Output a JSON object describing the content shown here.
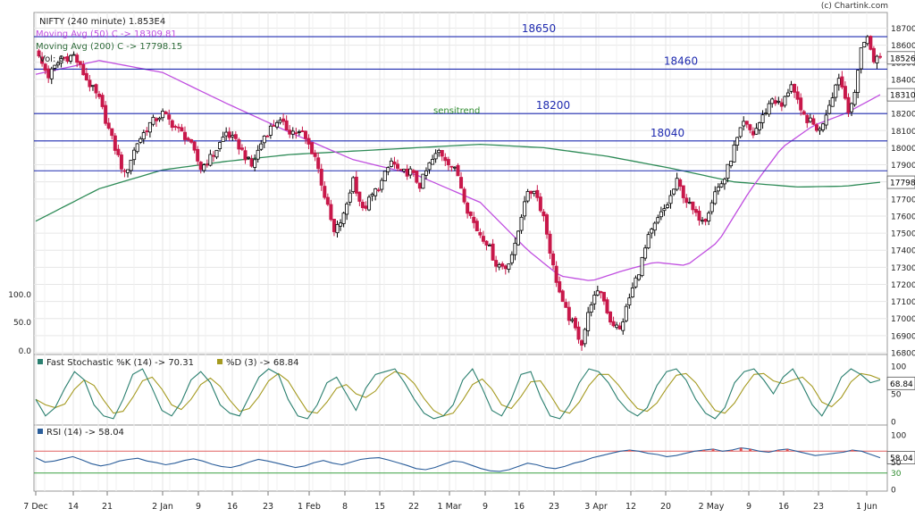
{
  "header": {
    "symbol_line": "NIFTY (240 minute) 1.853E4",
    "ma50_line": "Moving Avg (50) C -> 18309.81",
    "ma200_line": "Moving Avg (200) C -> 17798.15",
    "vol_line": "Vol: 0",
    "credit": "(c) Chartink.com"
  },
  "colors": {
    "up": "#000000",
    "down": "#c8184a",
    "ma50": "#c04fe0",
    "ma200": "#2e8b57",
    "hline": "#1f2bb0",
    "stoch_k": "#2a7f6f",
    "stoch_d": "#a59a20",
    "rsi": "#2a5d9a",
    "rsi_upper": "#e06060",
    "rsi_lower": "#3aa040",
    "grid": "#e6e6e6"
  },
  "chart_data": [
    {
      "type": "candlestick",
      "title": "NIFTY (240 minute) 1.853E4",
      "ylim": [
        16800,
        18700
      ],
      "y_ticks": [
        16800,
        16900,
        17000,
        17100,
        17200,
        17300,
        17400,
        17500,
        17600,
        17700,
        17800,
        17900,
        18000,
        18100,
        18200,
        18300,
        18400,
        18500,
        18600,
        18700
      ],
      "last_value_markers": [
        {
          "label": "18526",
          "value": 18526
        },
        {
          "label": "18310",
          "value": 18310
        },
        {
          "label": "17798",
          "value": 17798
        }
      ],
      "x_tick_labels": [
        "7 Dec",
        "14",
        "21",
        "2 Jan",
        "9",
        "16",
        "23",
        "1 Feb",
        "8",
        "15",
        "22",
        "1 Mar",
        "9",
        "16",
        "23",
        "3 Apr",
        "12",
        "20",
        "2 May",
        "9",
        "16",
        "23",
        "1 Jun"
      ],
      "horizontal_lines": [
        {
          "label": "18650",
          "value": 18650
        },
        {
          "label": "18460",
          "value": 18460
        },
        {
          "label": "18200",
          "value": 18200
        },
        {
          "label": "18040",
          "value": 18040
        },
        {
          "label": "",
          "value": 17865
        }
      ],
      "annotation": "sensitrend",
      "volume_axis_labels": [
        "100.0",
        "50.0",
        "0.0"
      ],
      "close_path": [
        [
          0,
          18560
        ],
        [
          4,
          18420
        ],
        [
          8,
          18520
        ],
        [
          12,
          18540
        ],
        [
          16,
          18400
        ],
        [
          20,
          18280
        ],
        [
          24,
          18050
        ],
        [
          28,
          17840
        ],
        [
          32,
          18030
        ],
        [
          36,
          18140
        ],
        [
          40,
          18200
        ],
        [
          44,
          18120
        ],
        [
          48,
          18050
        ],
        [
          52,
          17880
        ],
        [
          56,
          17960
        ],
        [
          60,
          18090
        ],
        [
          64,
          18010
        ],
        [
          68,
          17890
        ],
        [
          72,
          18070
        ],
        [
          76,
          18160
        ],
        [
          80,
          18100
        ],
        [
          84,
          18080
        ],
        [
          88,
          17950
        ],
        [
          91,
          17720
        ],
        [
          94,
          17500
        ],
        [
          97,
          17600
        ],
        [
          100,
          17820
        ],
        [
          103,
          17630
        ],
        [
          106,
          17720
        ],
        [
          109,
          17800
        ],
        [
          112,
          17920
        ],
        [
          115,
          17850
        ],
        [
          118,
          17860
        ],
        [
          121,
          17780
        ],
        [
          124,
          17900
        ],
        [
          127,
          17980
        ],
        [
          130,
          17920
        ],
        [
          133,
          17840
        ],
        [
          136,
          17640
        ],
        [
          139,
          17520
        ],
        [
          142,
          17450
        ],
        [
          145,
          17320
        ],
        [
          148,
          17300
        ],
        [
          151,
          17420
        ],
        [
          154,
          17700
        ],
        [
          157,
          17760
        ],
        [
          160,
          17600
        ],
        [
          163,
          17300
        ],
        [
          166,
          17080
        ],
        [
          169,
          16970
        ],
        [
          172,
          16860
        ],
        [
          175,
          17100
        ],
        [
          178,
          17160
        ],
        [
          181,
          16990
        ],
        [
          184,
          16930
        ],
        [
          187,
          17120
        ],
        [
          190,
          17280
        ],
        [
          193,
          17470
        ],
        [
          196,
          17580
        ],
        [
          199,
          17670
        ],
        [
          202,
          17800
        ],
        [
          205,
          17690
        ],
        [
          208,
          17600
        ],
        [
          211,
          17590
        ],
        [
          214,
          17740
        ],
        [
          217,
          17820
        ],
        [
          220,
          18000
        ],
        [
          223,
          18140
        ],
        [
          226,
          18080
        ],
        [
          229,
          18180
        ],
        [
          232,
          18290
        ],
        [
          235,
          18240
        ],
        [
          238,
          18380
        ],
        [
          241,
          18200
        ],
        [
          244,
          18150
        ],
        [
          247,
          18100
        ],
        [
          250,
          18260
        ],
        [
          253,
          18420
        ],
        [
          256,
          18230
        ],
        [
          258,
          18300
        ],
        [
          260,
          18600
        ],
        [
          262,
          18640
        ],
        [
          264,
          18520
        ],
        [
          266,
          18526
        ]
      ],
      "ma50_path": [
        [
          0,
          18430
        ],
        [
          20,
          18510
        ],
        [
          40,
          18440
        ],
        [
          60,
          18260
        ],
        [
          80,
          18090
        ],
        [
          100,
          17930
        ],
        [
          120,
          17840
        ],
        [
          140,
          17680
        ],
        [
          155,
          17400
        ],
        [
          165,
          17250
        ],
        [
          175,
          17220
        ],
        [
          185,
          17280
        ],
        [
          195,
          17330
        ],
        [
          205,
          17310
        ],
        [
          215,
          17450
        ],
        [
          225,
          17750
        ],
        [
          235,
          18000
        ],
        [
          245,
          18130
        ],
        [
          255,
          18200
        ],
        [
          266,
          18310
        ]
      ],
      "ma200_path": [
        [
          0,
          17570
        ],
        [
          20,
          17760
        ],
        [
          40,
          17870
        ],
        [
          60,
          17920
        ],
        [
          80,
          17960
        ],
        [
          100,
          17980
        ],
        [
          120,
          18000
        ],
        [
          140,
          18020
        ],
        [
          160,
          18000
        ],
        [
          180,
          17950
        ],
        [
          200,
          17880
        ],
        [
          220,
          17800
        ],
        [
          240,
          17770
        ],
        [
          255,
          17775
        ],
        [
          266,
          17798
        ]
      ]
    },
    {
      "type": "line",
      "title": "Fast Stochastic %K (14) -> 70.31",
      "series": [
        {
          "name": "Fast Stochastic %K (14) -> 70.31",
          "last": 70.31
        },
        {
          "name": "%D (3) -> 68.84",
          "last": 68.84
        }
      ],
      "ylim": [
        0,
        100
      ],
      "y_ticks": [
        0,
        50,
        100
      ],
      "last_value_marker": "68.84",
      "k_values": [
        40,
        10,
        25,
        60,
        90,
        75,
        30,
        10,
        5,
        40,
        85,
        95,
        60,
        20,
        10,
        35,
        75,
        90,
        70,
        30,
        15,
        10,
        45,
        80,
        95,
        85,
        40,
        10,
        5,
        30,
        70,
        80,
        50,
        20,
        60,
        85,
        90,
        95,
        70,
        40,
        15,
        5,
        10,
        30,
        75,
        95,
        60,
        20,
        10,
        40,
        85,
        90,
        45,
        10,
        5,
        30,
        70,
        95,
        90,
        70,
        40,
        20,
        10,
        25,
        65,
        90,
        95,
        75,
        40,
        15,
        5,
        25,
        70,
        90,
        95,
        75,
        50,
        80,
        95,
        65,
        30,
        10,
        40,
        80,
        95,
        85,
        70,
        75
      ]
    },
    {
      "type": "line",
      "title": "RSI (14) -> 58.04",
      "series": [
        {
          "name": "RSI (14) -> 58.04",
          "last": 58.04
        }
      ],
      "ylim": [
        0,
        100
      ],
      "y_ticks": [
        0,
        50,
        100
      ],
      "reference_lines": [
        {
          "label": "30",
          "value": 30
        },
        {
          "label": "",
          "value": 70
        }
      ],
      "last_value_marker": "58.04",
      "values": [
        58,
        50,
        52,
        56,
        60,
        54,
        47,
        43,
        46,
        52,
        55,
        57,
        52,
        49,
        45,
        48,
        53,
        56,
        52,
        46,
        42,
        40,
        44,
        50,
        55,
        52,
        48,
        44,
        40,
        43,
        49,
        53,
        48,
        45,
        50,
        55,
        57,
        58,
        54,
        49,
        44,
        38,
        36,
        40,
        46,
        52,
        50,
        44,
        38,
        34,
        33,
        36,
        42,
        48,
        45,
        40,
        38,
        42,
        48,
        52,
        58,
        62,
        66,
        70,
        72,
        70,
        66,
        64,
        60,
        62,
        66,
        70,
        72,
        74,
        70,
        72,
        76,
        74,
        70,
        68,
        72,
        74,
        70,
        66,
        62,
        64,
        66,
        68,
        72,
        70,
        64,
        58
      ]
    }
  ]
}
